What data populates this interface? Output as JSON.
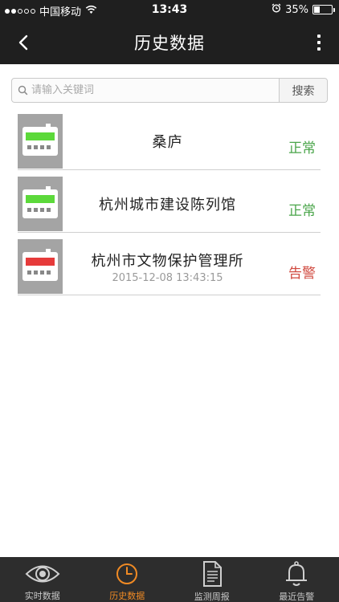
{
  "status_bar": {
    "carrier": "中国移动",
    "time": "13:43",
    "battery": "35%",
    "battery_level": 0.35
  },
  "nav": {
    "title": "历史数据"
  },
  "search": {
    "placeholder": "请输入关键词",
    "button_label": "搜索"
  },
  "items": [
    {
      "name": "桑庐",
      "time": "",
      "status": "正常",
      "status_type": "normal",
      "display_color": "#5cd93a"
    },
    {
      "name": "杭州城市建设陈列馆",
      "time": "",
      "status": "正常",
      "status_type": "normal",
      "display_color": "#5cd93a"
    },
    {
      "name": "杭州市文物保护管理所",
      "time": "2015-12-08 13:43:15",
      "status": "告警",
      "status_type": "alarm",
      "display_color": "#e63b3b"
    }
  ],
  "tabs": [
    {
      "label": "实时数据",
      "icon": "eye-icon",
      "active": false
    },
    {
      "label": "历史数据",
      "icon": "clock-icon",
      "active": true
    },
    {
      "label": "监测周报",
      "icon": "document-icon",
      "active": false
    },
    {
      "label": "最近告警",
      "icon": "bell-icon",
      "active": false
    }
  ],
  "colors": {
    "header_bg": "#1f1f1f",
    "tabbar_bg": "#2d2d2d",
    "accent_active": "#f08a24",
    "status_normal": "#4aa54a",
    "status_alarm": "#d0493f"
  }
}
